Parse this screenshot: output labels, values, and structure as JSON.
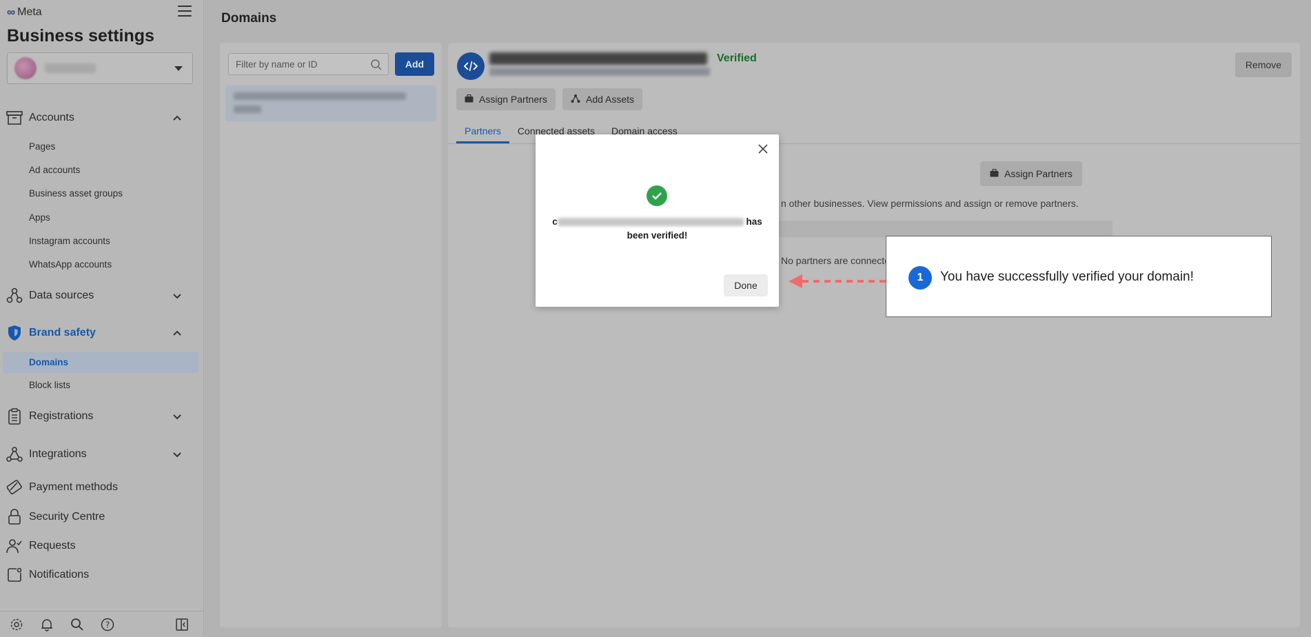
{
  "brand": {
    "name": "Meta"
  },
  "app": {
    "title": "Business settings"
  },
  "nav": {
    "accounts": {
      "label": "Accounts",
      "items": [
        "Pages",
        "Ad accounts",
        "Business asset groups",
        "Apps",
        "Instagram accounts",
        "WhatsApp accounts"
      ]
    },
    "data_sources": {
      "label": "Data sources"
    },
    "brand_safety": {
      "label": "Brand safety",
      "items": [
        "Domains",
        "Block lists"
      ]
    },
    "registrations": {
      "label": "Registrations"
    },
    "integrations": {
      "label": "Integrations"
    },
    "payment_methods": {
      "label": "Payment methods"
    },
    "security_centre": {
      "label": "Security Centre"
    },
    "requests": {
      "label": "Requests"
    },
    "notifications": {
      "label": "Notifications"
    }
  },
  "main": {
    "title": "Domains",
    "filter_placeholder": "Filter by name or ID",
    "add_label": "Add",
    "verified_label": "Verified",
    "remove_label": "Remove",
    "assign_partners_label": "Assign Partners",
    "add_assets_label": "Add Assets",
    "tabs": [
      "Partners",
      "Connected assets",
      "Domain access"
    ],
    "partners_desc": "n other businesses. View permissions and assign or remove partners.",
    "no_partners": "No partners are connecte"
  },
  "modal": {
    "first_char": "c",
    "message_tail": " has",
    "message_line2": "been verified!",
    "done_label": "Done"
  },
  "callout": {
    "step": "1",
    "text": "You have successfully verified your domain!"
  },
  "colors": {
    "accent": "#1877f2",
    "success": "#31a24c",
    "verified": "#1c6b2c"
  }
}
